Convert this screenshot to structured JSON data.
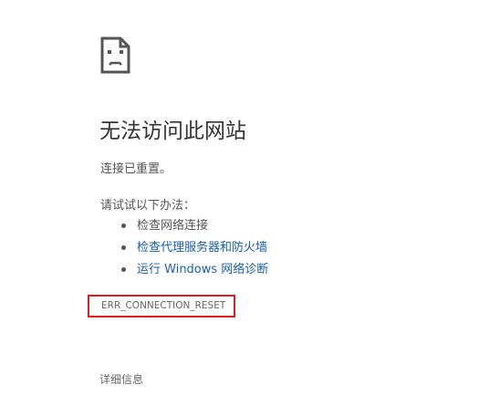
{
  "error_page": {
    "icon": "sad-page-icon",
    "title": "无法访问此网站",
    "subtitle": "连接已重置。",
    "suggestions_heading": "请试试以下办法：",
    "suggestions": [
      {
        "label": "检查网络连接",
        "is_link": false
      },
      {
        "label": "检查代理服务器和防火墙",
        "is_link": true
      },
      {
        "label": "运行 Windows 网络诊断",
        "is_link": true
      }
    ],
    "error_code": "ERR_CONNECTION_RESET",
    "details_label": "详细信息"
  },
  "colors": {
    "link": "#1a5fb4",
    "highlight_box": "#e01b24",
    "text": "#555555"
  }
}
